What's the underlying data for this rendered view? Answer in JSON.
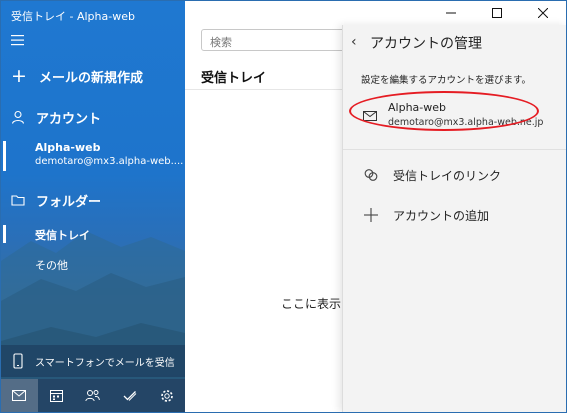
{
  "window": {
    "title": "受信トレイ - Alpha-web"
  },
  "nav": {
    "new_mail_label": "メールの新規作成",
    "accounts_header": "アカウント",
    "account": {
      "name": "Alpha-web",
      "email": "demotaro@mx3.alpha-web...."
    },
    "folders_header": "フォルダー",
    "folders": [
      {
        "label": "受信トレイ",
        "selected": true
      },
      {
        "label": "その他",
        "selected": false
      }
    ],
    "phone_label": "スマートフォンでメールを受信",
    "bottom_icons": [
      "mail-icon",
      "calendar-icon",
      "people-icon",
      "todo-icon",
      "settings-icon"
    ]
  },
  "list": {
    "search_placeholder": "検索",
    "header": "受信トレイ",
    "empty_text": "ここに表示す"
  },
  "panel": {
    "title": "アカウントの管理",
    "description": "設定を編集するアカウントを選びます。",
    "account": {
      "name": "Alpha-web",
      "email": "demotaro@mx3.alpha-web.ne.jp"
    },
    "link_inboxes": "受信トレイのリンク",
    "add_account": "アカウントの追加"
  },
  "colors": {
    "nav_blue": "#1f78d1",
    "highlight_oval": "#e51c23"
  }
}
